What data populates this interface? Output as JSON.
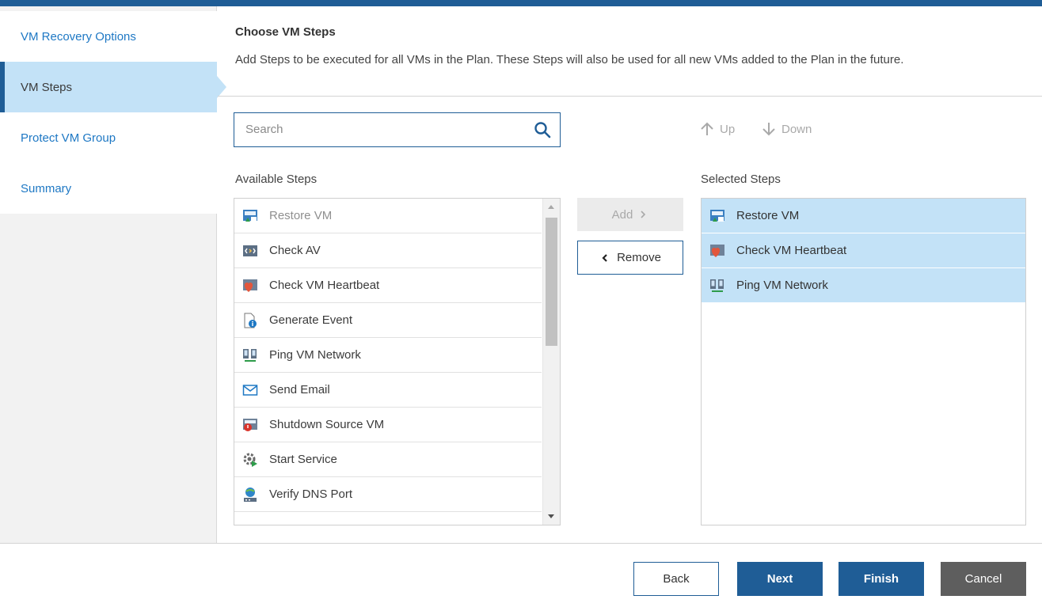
{
  "sidebar": {
    "items": [
      {
        "label": "VM Recovery Options"
      },
      {
        "label": "VM Steps"
      },
      {
        "label": "Protect VM Group"
      },
      {
        "label": "Summary"
      }
    ]
  },
  "header": {
    "title": "Choose VM Steps",
    "description": "Add Steps to be executed for all VMs in the Plan. These Steps will also be used for all new VMs added to the Plan in the future."
  },
  "search": {
    "placeholder": "Search",
    "value": ""
  },
  "order": {
    "up_label": "Up",
    "down_label": "Down"
  },
  "available": {
    "label": "Available Steps",
    "items": [
      {
        "label": "Restore VM",
        "icon": "restore-vm-icon"
      },
      {
        "label": "Check AV",
        "icon": "check-av-icon"
      },
      {
        "label": "Check VM Heartbeat",
        "icon": "heartbeat-icon"
      },
      {
        "label": "Generate Event",
        "icon": "generate-event-icon"
      },
      {
        "label": "Ping VM Network",
        "icon": "ping-network-icon"
      },
      {
        "label": "Send Email",
        "icon": "email-icon"
      },
      {
        "label": "Shutdown Source VM",
        "icon": "shutdown-icon"
      },
      {
        "label": "Start Service",
        "icon": "start-service-icon"
      },
      {
        "label": "Verify DNS Port",
        "icon": "dns-port-icon"
      }
    ]
  },
  "actions": {
    "add_label": "Add",
    "remove_label": "Remove"
  },
  "selected": {
    "label": "Selected Steps",
    "items": [
      {
        "label": "Restore VM",
        "icon": "restore-vm-icon"
      },
      {
        "label": "Check VM Heartbeat",
        "icon": "heartbeat-icon"
      },
      {
        "label": "Ping VM Network",
        "icon": "ping-network-icon"
      }
    ]
  },
  "footer": {
    "back_label": "Back",
    "next_label": "Next",
    "finish_label": "Finish",
    "cancel_label": "Cancel"
  },
  "colors": {
    "accent": "#1f5d96",
    "selected_bg": "#c3e2f7",
    "link": "#1e78c4",
    "cancel": "#5e5e5e"
  }
}
